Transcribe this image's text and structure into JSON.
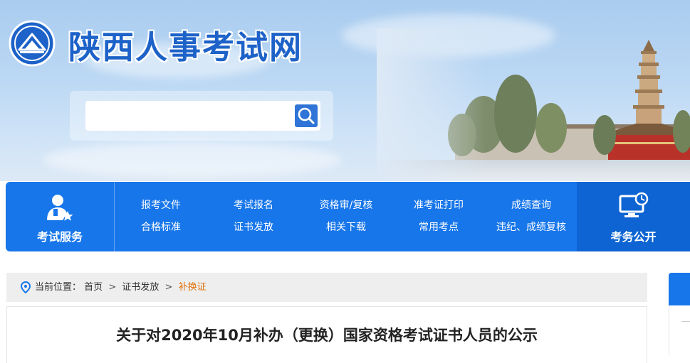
{
  "header": {
    "site_title": "陕西人事考试网",
    "search": {
      "placeholder": ""
    }
  },
  "nav": {
    "left": {
      "label": "考试服务",
      "icon": "user-star-icon"
    },
    "columns": [
      [
        "报考文件",
        "合格标准"
      ],
      [
        "考试报名",
        "证书发放"
      ],
      [
        "资格审/复核",
        "相关下载"
      ],
      [
        "准考证打印",
        "常用考点"
      ],
      [
        "成绩查询",
        "违纪、成绩复核"
      ]
    ],
    "right": {
      "label": "考务公开",
      "icon": "monitor-clock-icon"
    }
  },
  "breadcrumb": {
    "prefix": "当前位置：",
    "items": [
      "首页",
      "证书发放",
      "补换证"
    ],
    "separator": ">"
  },
  "article": {
    "title": "关于对2020年10月补办（更换）国家资格考试证书人员的公示"
  },
  "colors": {
    "nav_blue": "#1776ea",
    "nav_dark": "#0d64d2",
    "title_blue": "#1d62c8",
    "crumb_current": "#e0730f"
  }
}
